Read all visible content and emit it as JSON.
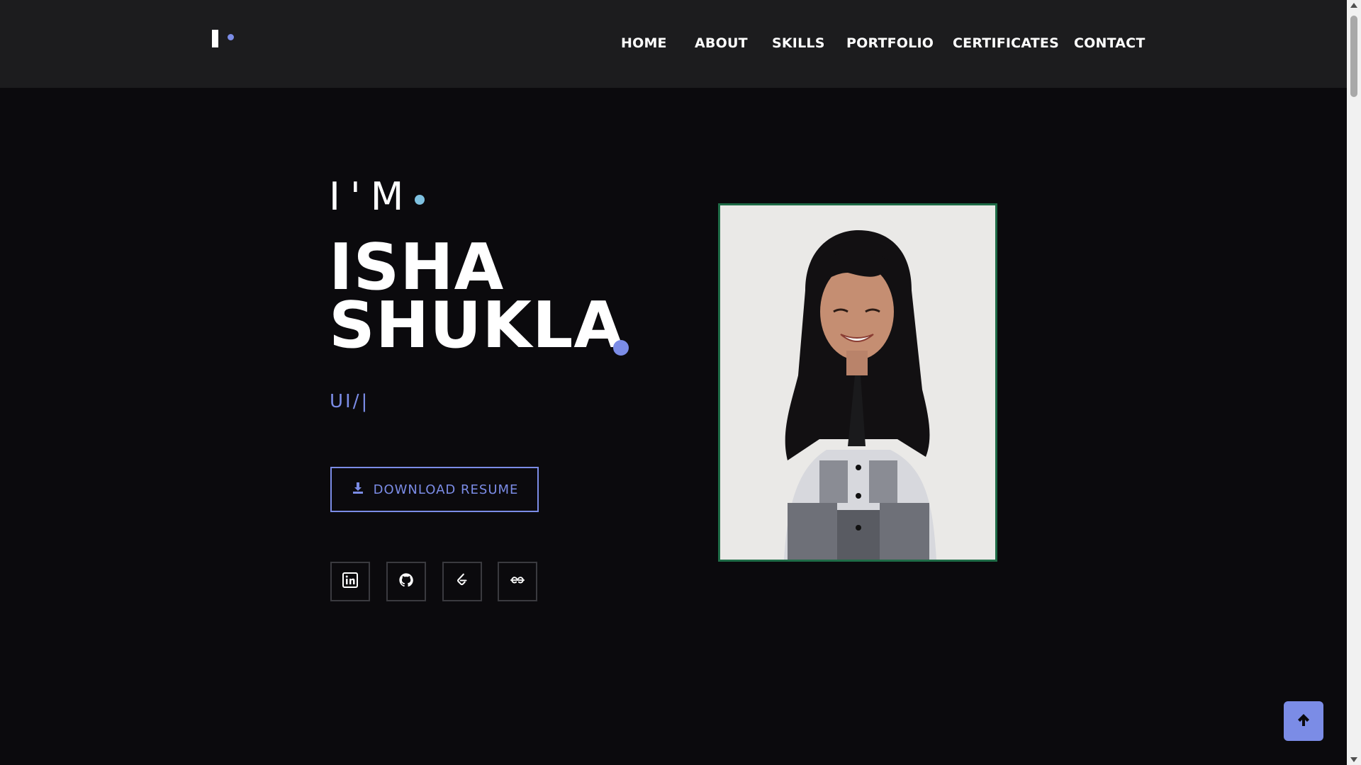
{
  "header": {
    "nav": [
      {
        "label": "HOME"
      },
      {
        "label": "ABOUT"
      },
      {
        "label": "SKILLS"
      },
      {
        "label": "PORTFOLIO"
      },
      {
        "label": "CERTIFICATES"
      },
      {
        "label": "CONTACT"
      }
    ]
  },
  "hero": {
    "intro": "I'M",
    "name_line1": "ISHA",
    "name_line2": "SHUKLA",
    "typed_role": "UI/|",
    "resume_label": "DOWNLOAD RESUME"
  },
  "social_icons": [
    "linkedin-icon",
    "github-icon",
    "leetcode-icon",
    "geeksforgeeks-icon"
  ],
  "colors": {
    "accent": "#7b8ce6",
    "accent_light": "#7ec1e0",
    "background": "#0b0a0d",
    "header_bg": "#1c1c1e",
    "photo_border": "#1e6b46"
  }
}
